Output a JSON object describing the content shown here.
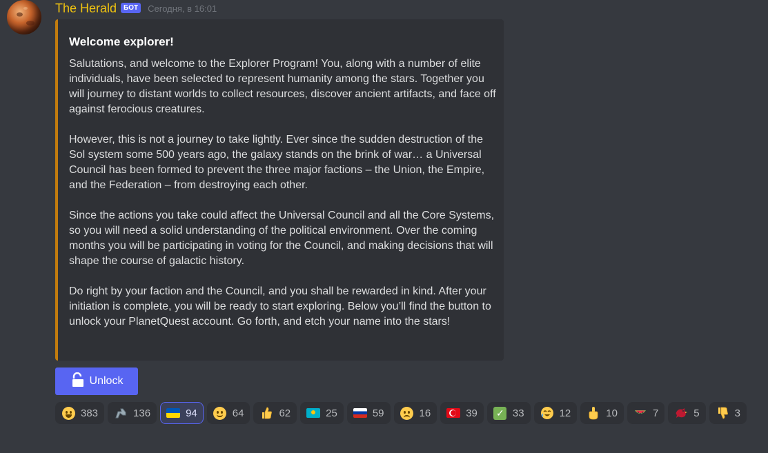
{
  "author": {
    "name": "The Herald",
    "bot_tag": "БОТ",
    "timestamp": "Сегодня, в 16:01",
    "name_color": "#f1c40f"
  },
  "embed": {
    "accent_color": "#c27c0e",
    "title": "Welcome explorer!",
    "paragraphs": [
      "Salutations, and welcome to the Explorer Program! You, along with a number of elite individuals, have been selected to represent humanity among the stars. Together you will journey to distant worlds to collect resources, discover ancient artifacts, and face off against ferocious creatures.",
      "However, this is not a journey to take lightly. Ever since the sudden destruction of the Sol system some 500 years ago, the galaxy stands on the brink of war… a Universal Council has been formed to prevent the three major factions – the Union, the Empire, and the Federation – from destroying each other.",
      "Since the actions you take could affect the Universal Council and all the Core Systems, so you will need a solid understanding of the political environment. Over the coming months you will be participating in voting for the Council, and making decisions that will shape the course of galactic history.",
      "Do right by your faction and the Council, and you shall be rewarded in kind. After your initiation is complete, you will be ready to start exploring. Below you’ll find the button to unlock your PlanetQuest account. Go forth, and etch your name into the stars!"
    ]
  },
  "button": {
    "label": "Unlock",
    "icon": "unlock-icon",
    "color": "#5865f2"
  },
  "reactions": [
    {
      "emoji": "smiley-face",
      "count": "383"
    },
    {
      "emoji": "mechanical-arm",
      "count": "136"
    },
    {
      "emoji": "flag-ukraine",
      "count": "94",
      "active": true
    },
    {
      "emoji": "grinning-face",
      "count": "64"
    },
    {
      "emoji": "thumbs-up",
      "count": "62"
    },
    {
      "emoji": "flag-kazakhstan",
      "count": "25"
    },
    {
      "emoji": "flag-russia",
      "count": "59"
    },
    {
      "emoji": "frowning-face",
      "count": "16"
    },
    {
      "emoji": "flag-turkey",
      "count": "39"
    },
    {
      "emoji": "check-mark",
      "count": "33"
    },
    {
      "emoji": "crying-laughing-face",
      "count": "12"
    },
    {
      "emoji": "middle-finger",
      "count": "10"
    },
    {
      "emoji": "watermelon",
      "count": "7"
    },
    {
      "emoji": "red-bird",
      "count": "5"
    },
    {
      "emoji": "thumbs-down",
      "count": "3"
    }
  ]
}
